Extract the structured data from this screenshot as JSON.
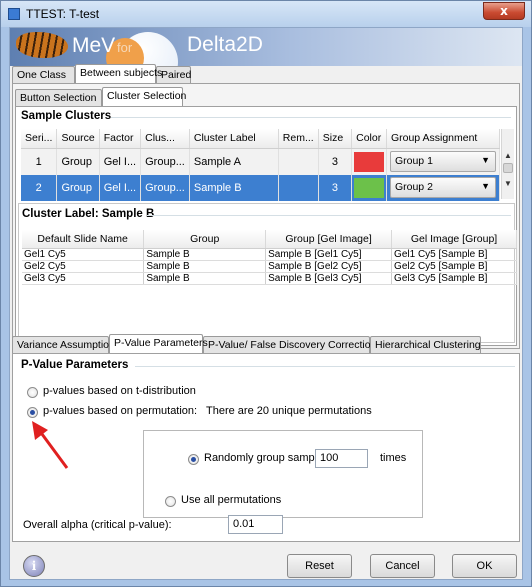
{
  "window": {
    "title": "TTEST: T-test",
    "close_label": "x"
  },
  "banner": {
    "mev": "MeV",
    "for": "for",
    "delta": "Delta2D"
  },
  "design_tabs": [
    "One Class",
    "Between subjects",
    "Paired"
  ],
  "design_active": 1,
  "sub_tabs": [
    "Button Selection",
    "Cluster Selection"
  ],
  "sub_active": 1,
  "sample_clusters": {
    "title": "Sample Clusters",
    "columns": [
      "Seri...",
      "Source",
      "Factor",
      "Clus...",
      "Cluster Label",
      "Rem...",
      "Size",
      "Color",
      "Group Assignment"
    ],
    "rows": [
      {
        "serial": "1",
        "source": "Group",
        "factor": "Gel I...",
        "cluster": "Group...",
        "label": "Sample A",
        "remarks": "",
        "size": "3",
        "color": "#e83b3b",
        "group": "Group 1"
      },
      {
        "serial": "2",
        "source": "Group",
        "factor": "Gel I...",
        "cluster": "Group...",
        "label": "Sample B",
        "remarks": "",
        "size": "3",
        "color": "#6cc14a",
        "group": "Group 2"
      }
    ]
  },
  "cluster_label": {
    "title": "Cluster Label: Sample B",
    "columns": [
      "Default Slide Name",
      "Group",
      "Group [Gel Image]",
      "Gel Image [Group]"
    ],
    "rows": [
      [
        "Gel1 Cy5",
        "Sample B",
        "Sample B [Gel1 Cy5]",
        "Gel1 Cy5 [Sample B]"
      ],
      [
        "Gel2 Cy5",
        "Sample B",
        "Sample B [Gel2 Cy5]",
        "Gel2 Cy5 [Sample B]"
      ],
      [
        "Gel3 Cy5",
        "Sample B",
        "Sample B [Gel3 Cy5]",
        "Gel3 Cy5 [Sample B]"
      ]
    ]
  },
  "param_tabs": [
    "Variance Assumption",
    "P-Value Parameters",
    "P-Value/ False Discovery Corrections",
    "Hierarchical Clustering"
  ],
  "param_active": 1,
  "pvalue": {
    "title": "P-Value Parameters",
    "t_dist": "p-values based on t-distribution",
    "permutation": "p-values based on permutation:",
    "unique_perms": "There are 20 unique permutations",
    "random_label": "Randomly group samples",
    "random_value": "100",
    "times": "times",
    "use_all": "Use all permutations",
    "alpha_label": "Overall alpha (critical p-value):",
    "alpha_value": "0.01"
  },
  "buttons": {
    "info": "i",
    "reset": "Reset",
    "cancel": "Cancel",
    "ok": "OK"
  },
  "annotation_color": "#e02020"
}
